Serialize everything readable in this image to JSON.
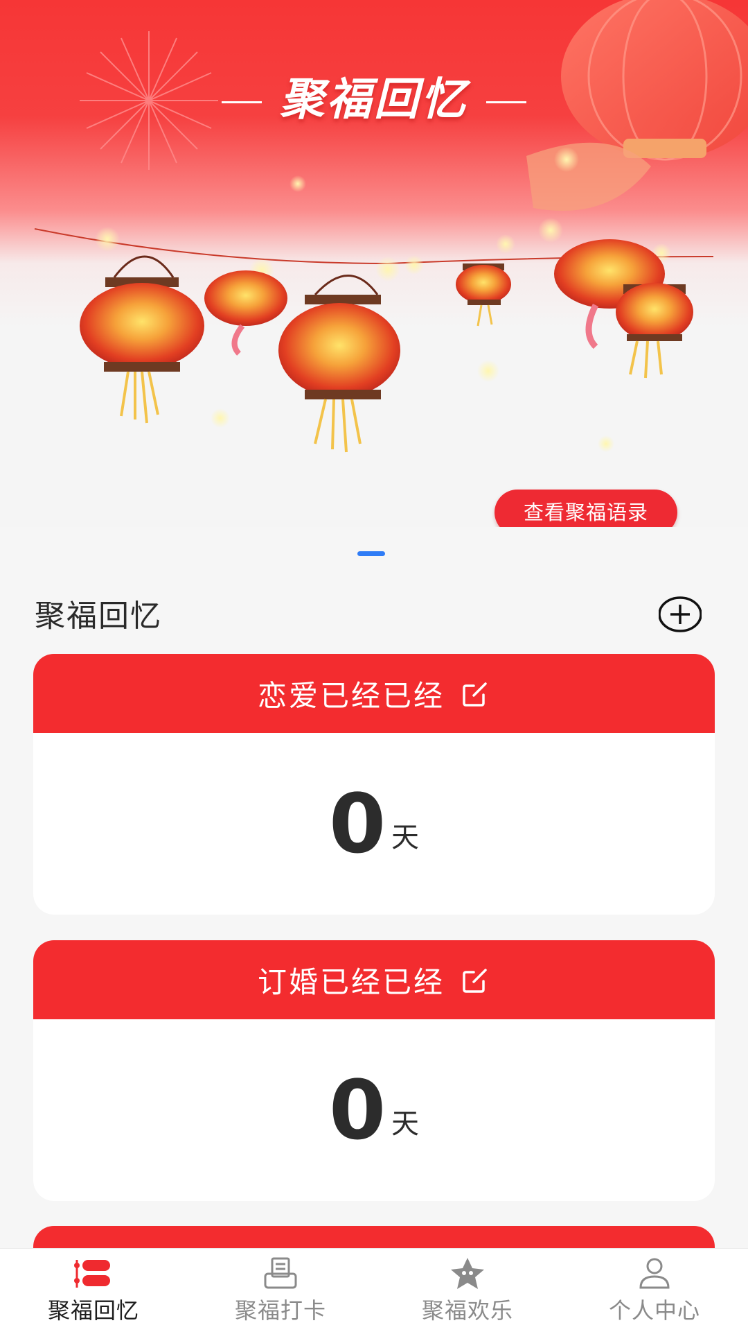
{
  "banner": {
    "title": "聚福回忆",
    "quote_button": "查看聚福语录"
  },
  "section": {
    "title": "聚福回忆",
    "add_icon": "plus-circle-icon"
  },
  "cards": [
    {
      "title": "恋爱已经已经",
      "count": "0",
      "unit": "天",
      "edit_icon": "edit-icon"
    },
    {
      "title": "订婚已经已经",
      "count": "0",
      "unit": "天",
      "edit_icon": "edit-icon"
    }
  ],
  "tabs": [
    {
      "label": "聚福回忆",
      "icon": "list-icon",
      "active": true
    },
    {
      "label": "聚福打卡",
      "icon": "printer-icon",
      "active": false
    },
    {
      "label": "聚福欢乐",
      "icon": "star-icon",
      "active": false
    },
    {
      "label": "个人中心",
      "icon": "person-icon",
      "active": false
    }
  ],
  "colors": {
    "primary_red": "#f32c2f",
    "button_red": "#ee2a33",
    "indicator_blue": "#2f7cf6",
    "background": "#f6f6f6"
  }
}
